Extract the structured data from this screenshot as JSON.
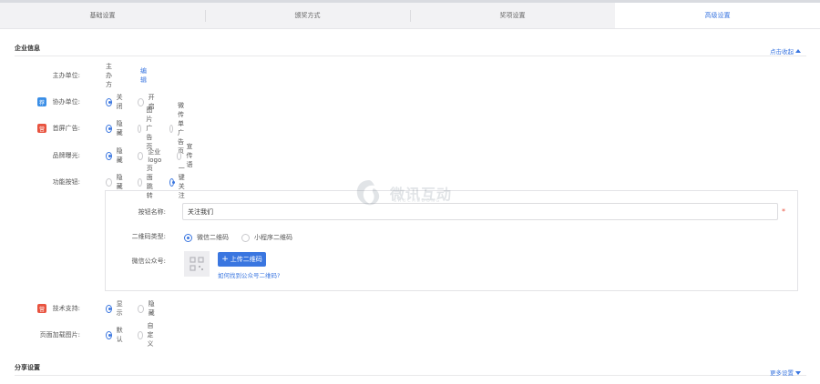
{
  "tabs": [
    {
      "label": "基础设置",
      "active": false
    },
    {
      "label": "颁奖方式",
      "active": false
    },
    {
      "label": "奖项设置",
      "active": false
    },
    {
      "label": "高级设置",
      "active": true
    }
  ],
  "company_section": {
    "title": "企业信息",
    "toggle": "点击收起"
  },
  "host": {
    "label": "主办单位:",
    "value": "主办方",
    "edit": "编辑"
  },
  "co_host": {
    "label": "协办单位:",
    "badge": "荐",
    "options": [
      "关闭",
      "开启"
    ],
    "selected": 0
  },
  "home_ad": {
    "label": "首屏广告:",
    "badge": "营",
    "options": [
      "隐藏",
      "图片广告页",
      "微传单广告页"
    ],
    "selected": 0
  },
  "brand_exposure": {
    "label": "品牌曝光:",
    "options": [
      "隐藏",
      "企业logo",
      "宣传语"
    ],
    "selected": 0
  },
  "function_button": {
    "label": "功能按钮:",
    "options": [
      "隐藏",
      "页面跳转",
      "一键关注"
    ],
    "selected": 2
  },
  "button_config": {
    "name_label": "按钮名称:",
    "name_value": "关注我们",
    "required_mark": "*",
    "qr_type_label": "二维码类型:",
    "qr_type_options": [
      "微信二维码",
      "小程序二维码"
    ],
    "qr_type_selected": 0,
    "wechat_label": "微信公众号:",
    "upload_button": "上传二维码",
    "help_link": "如何找到公众号二维码?"
  },
  "tech_support": {
    "label": "技术支持:",
    "badge": "营",
    "options": [
      "显示",
      "隐藏"
    ],
    "selected": 0
  },
  "loading_image": {
    "label": "页面加载图片:",
    "options": [
      "默认",
      "自定义"
    ],
    "selected": 0
  },
  "share_section": {
    "title": "分享设置",
    "toggle": "更多设置"
  },
  "watermark": {
    "text": "微讯互动",
    "sub": "SHUCHUDONG"
  },
  "colors": {
    "accent": "#3a76e0",
    "badge_blue": "#3a8ee6",
    "badge_red": "#e8533f"
  }
}
